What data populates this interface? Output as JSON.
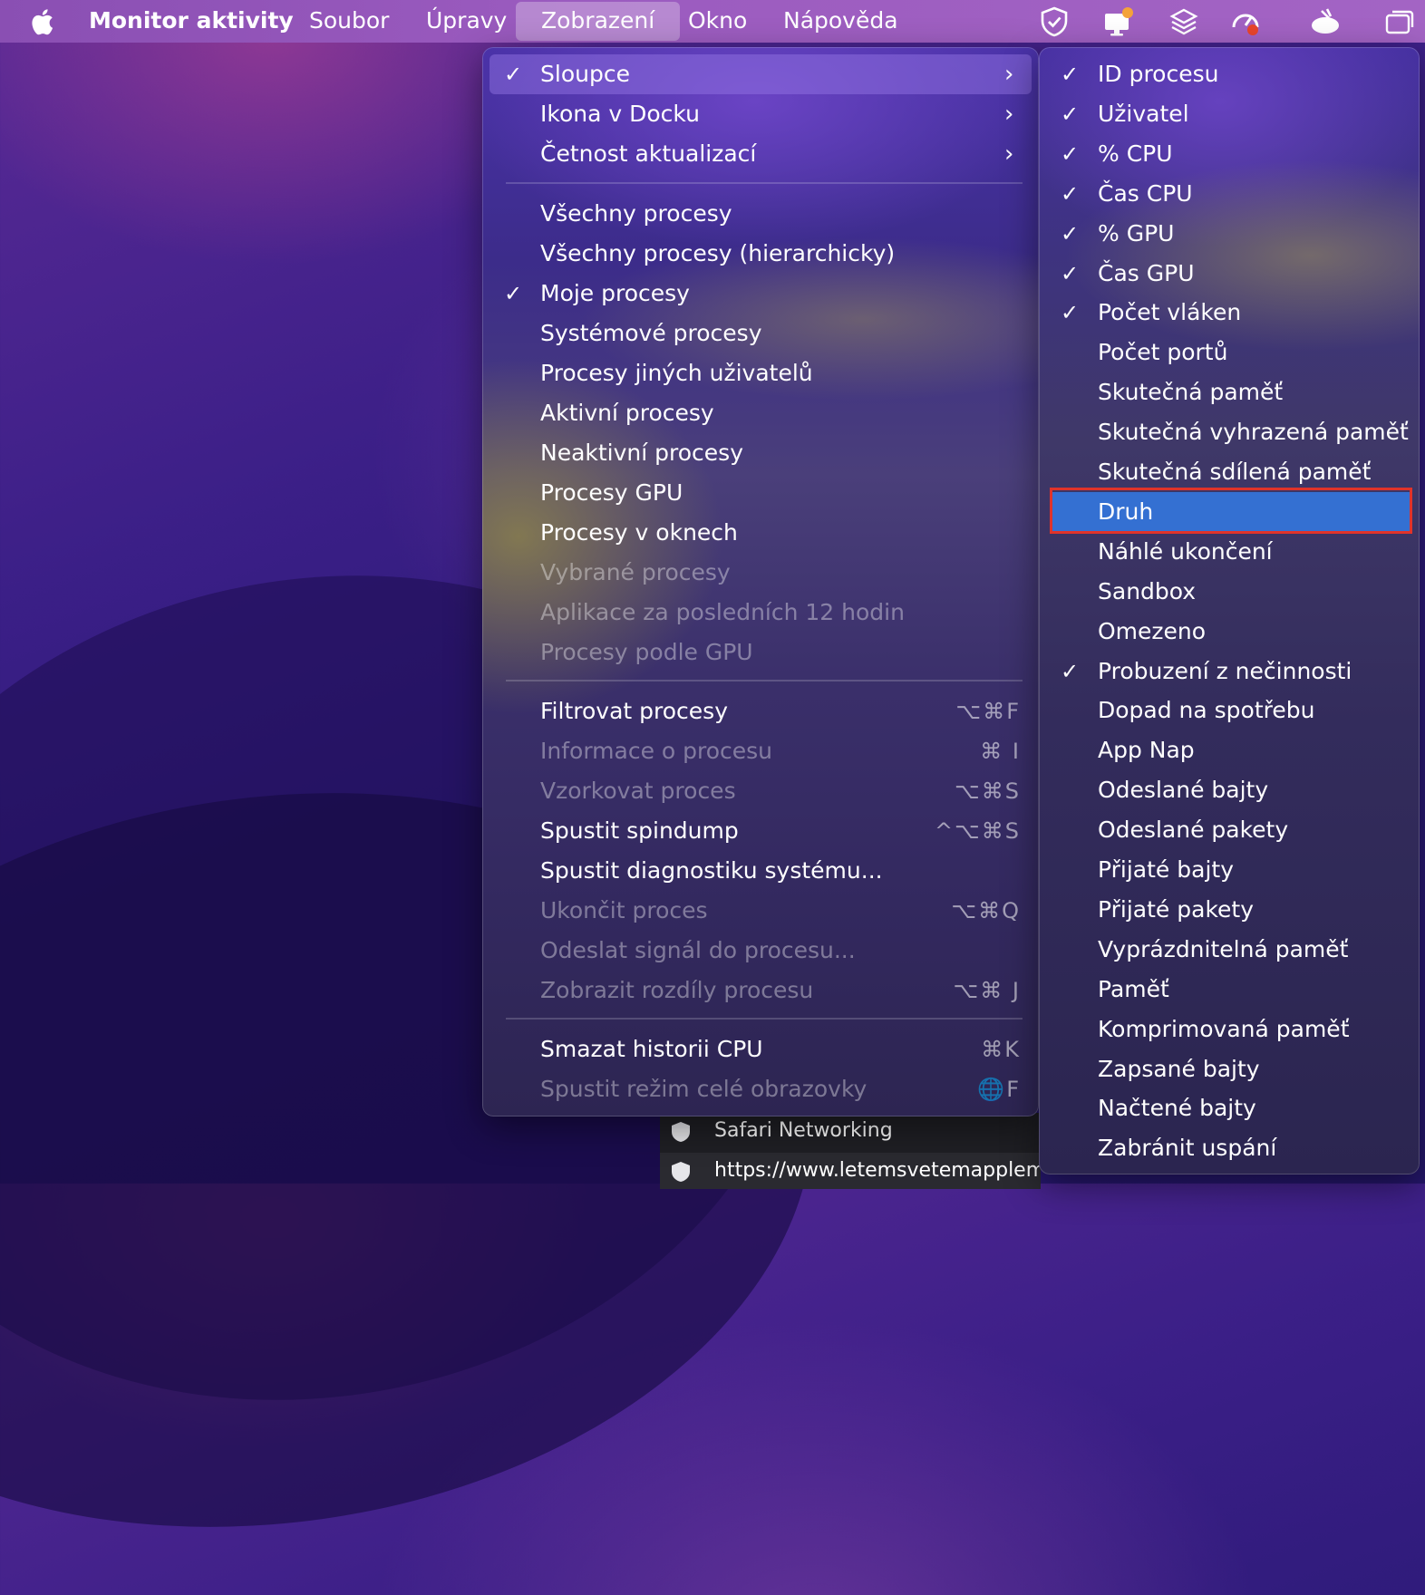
{
  "menubar": {
    "app_name": "Monitor aktivity",
    "items": [
      "Soubor",
      "Úpravy",
      "Zobrazení",
      "Okno",
      "Nápověda"
    ],
    "active": "Zobrazení"
  },
  "view_menu": {
    "items": [
      {
        "label": "Sloupce",
        "checked": true,
        "submenu": true,
        "disabled": false
      },
      {
        "label": "Ikona v Docku",
        "checked": false,
        "submenu": true,
        "disabled": false
      },
      {
        "label": "Četnost aktualizací",
        "checked": false,
        "submenu": true,
        "disabled": false
      },
      {
        "label": "Všechny procesy",
        "checked": false,
        "disabled": false
      },
      {
        "label": "Všechny procesy (hierarchicky)",
        "checked": false,
        "disabled": false
      },
      {
        "label": "Moje procesy",
        "checked": true,
        "disabled": false
      },
      {
        "label": "Systémové procesy",
        "checked": false,
        "disabled": false
      },
      {
        "label": "Procesy jiných uživatelů",
        "checked": false,
        "disabled": false
      },
      {
        "label": "Aktivní procesy",
        "checked": false,
        "disabled": false
      },
      {
        "label": "Neaktivní procesy",
        "checked": false,
        "disabled": false
      },
      {
        "label": "Procesy GPU",
        "checked": false,
        "disabled": false
      },
      {
        "label": "Procesy v oknech",
        "checked": false,
        "disabled": false
      },
      {
        "label": "Vybrané procesy",
        "checked": false,
        "disabled": true
      },
      {
        "label": "Aplikace za posledních 12 hodin",
        "checked": false,
        "disabled": true
      },
      {
        "label": "Procesy podle GPU",
        "checked": false,
        "disabled": true
      },
      {
        "label": "Filtrovat procesy",
        "shortcut": "⌥⌘F",
        "disabled": false
      },
      {
        "label": "Informace o procesu",
        "shortcut": "⌘ I",
        "disabled": true
      },
      {
        "label": "Vzorkovat proces",
        "shortcut": "⌥⌘S",
        "disabled": true
      },
      {
        "label": "Spustit spindump",
        "shortcut": "^⌥⌘S",
        "disabled": false
      },
      {
        "label": "Spustit diagnostiku systému...",
        "shortcut": "",
        "disabled": false
      },
      {
        "label": "Ukončit proces",
        "shortcut": "⌥⌘Q",
        "disabled": true
      },
      {
        "label": "Odeslat signál do procesu...",
        "shortcut": "",
        "disabled": true
      },
      {
        "label": "Zobrazit rozdíly procesu",
        "shortcut": "⌥⌘ J",
        "disabled": true
      },
      {
        "label": "Smazat historii CPU",
        "shortcut": "⌘K",
        "disabled": false
      },
      {
        "label": "Spustit režim celé obrazovky",
        "shortcut": "🌐F",
        "disabled": true
      }
    ]
  },
  "columns_submenu": {
    "items": [
      {
        "label": "ID procesu",
        "checked": true
      },
      {
        "label": "Uživatel",
        "checked": true
      },
      {
        "label": "% CPU",
        "checked": true
      },
      {
        "label": "Čas CPU",
        "checked": true
      },
      {
        "label": "% GPU",
        "checked": true
      },
      {
        "label": "Čas GPU",
        "checked": true
      },
      {
        "label": "Počet vláken",
        "checked": true
      },
      {
        "label": "Počet portů",
        "checked": false
      },
      {
        "label": "Skutečná paměť",
        "checked": false
      },
      {
        "label": "Skutečná vyhrazená paměť",
        "checked": false
      },
      {
        "label": "Skutečná sdílená paměť",
        "checked": false
      },
      {
        "label": "Druh",
        "checked": false,
        "highlighted": true
      },
      {
        "label": "Náhlé ukončení",
        "checked": false
      },
      {
        "label": "Sandbox",
        "checked": false
      },
      {
        "label": "Omezeno",
        "checked": false
      },
      {
        "label": "Probuzení z nečinnosti",
        "checked": true
      },
      {
        "label": "Dopad na spotřebu",
        "checked": false
      },
      {
        "label": "App Nap",
        "checked": false
      },
      {
        "label": "Odeslané bajty",
        "checked": false
      },
      {
        "label": "Odeslané pakety",
        "checked": false
      },
      {
        "label": "Přijaté bajty",
        "checked": false
      },
      {
        "label": "Přijaté pakety",
        "checked": false
      },
      {
        "label": "Vyprázdnitelná paměť",
        "checked": false
      },
      {
        "label": "Paměť",
        "checked": false
      },
      {
        "label": "Komprimovaná paměť",
        "checked": false
      },
      {
        "label": "Zapsané bajty",
        "checked": false
      },
      {
        "label": "Načtené bajty",
        "checked": false
      },
      {
        "label": "Zabránit uspání",
        "checked": false
      }
    ]
  },
  "process_list": {
    "rows": [
      "Safari Networking",
      "https://www.letemsvetemapplem.e"
    ]
  },
  "check_glyph": "✓",
  "submenu_glyph": "›",
  "colors": {
    "highlight_blue": "#3470d2",
    "annotation_red": "#e0332a",
    "menubar": "#9b5bbf"
  }
}
